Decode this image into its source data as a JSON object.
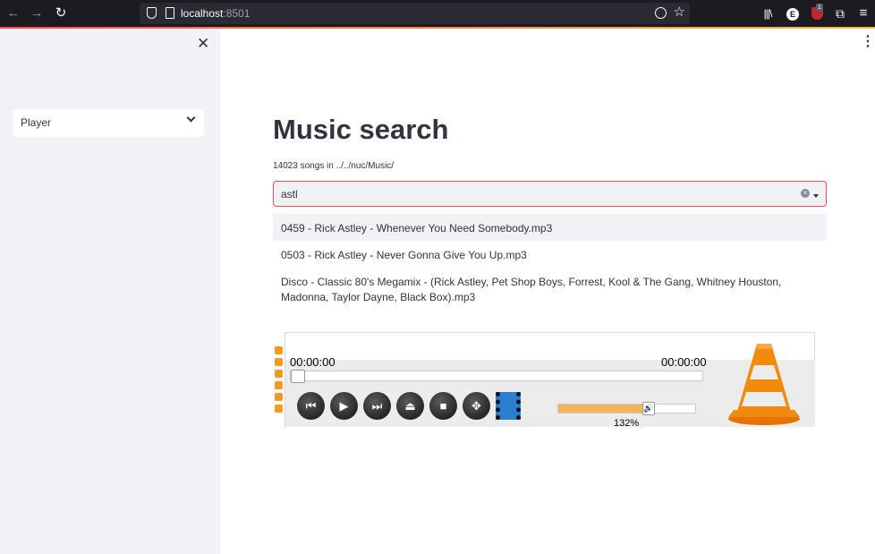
{
  "browser": {
    "url_host": "localhost",
    "url_port": ":8501",
    "extension_e_label": "E",
    "ublock_badge": "1"
  },
  "sidebar": {
    "select_value": "Player"
  },
  "main": {
    "title": "Music search",
    "caption": "14023 songs in ../../nuc/Music/",
    "search_value": "astl",
    "results": [
      "0459 - Rick Astley - Whenever You Need Somebody.mp3",
      "0503 - Rick Astley - Never Gonna Give You Up.mp3",
      "Disco - Classic 80's Megamix - (Rick Astley, Pet Shop Boys, Forrest, Kool & The Gang, Whitney Houston, Madonna, Taylor Dayne, Black Box).mp3"
    ]
  },
  "player": {
    "elapsed": "00:00:00",
    "duration": "00:00:00",
    "volume_label": "132%",
    "volume_fraction": 0.66,
    "seek_fraction": 0,
    "controls": [
      "previous-icon",
      "play-icon",
      "next-icon",
      "eject-icon",
      "stop-icon",
      "fullscreen-icon",
      "film-icon"
    ],
    "accent_color": "#f7b35b"
  },
  "colors": {
    "accent": "#ff4b4b",
    "sidebar_bg": "#f0f2f6",
    "text": "#31333f"
  }
}
